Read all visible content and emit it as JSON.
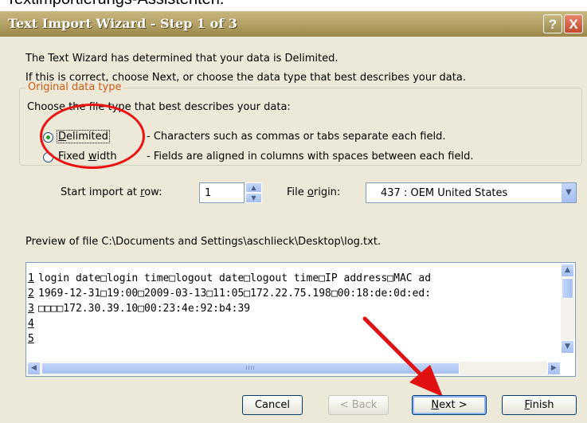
{
  "caption": "Textimportierungs-Assistenten.",
  "window": {
    "title": "Text Import Wizard - Step 1 of 3",
    "help_glyph": "?",
    "close_glyph": "X"
  },
  "intro": {
    "line1": "The Text Wizard has determined that your data is Delimited.",
    "line2": "If this is correct, choose Next, or choose the data type that best describes your data."
  },
  "original_data_type": {
    "legend": "Original data type",
    "prompt": "Choose the file type that best describes your data:",
    "options": [
      {
        "label_first": "D",
        "label_rest": "elimited",
        "description": "- Characters such as commas or tabs separate each field.",
        "selected": true
      },
      {
        "label_pre": "Fixed ",
        "label_u": "w",
        "label_post": "idth",
        "description": "- Fields are aligned in columns with spaces between each field.",
        "selected": false
      }
    ]
  },
  "start_import": {
    "label_pre": "Start import at ",
    "label_u": "r",
    "label_post": "ow:",
    "value": "1"
  },
  "file_origin": {
    "label_pre": "File ",
    "label_u": "o",
    "label_post": "rigin:",
    "value": "437 : OEM United States"
  },
  "preview": {
    "label": "Preview of file C:\\Documents and Settings\\aschlieck\\Desktop\\log.txt.",
    "rows": [
      {
        "num": "1",
        "text": "login date□login time□logout date□logout time□IP address□MAC ad"
      },
      {
        "num": "2",
        "text": "1969-12-31□19:00□2009-03-13□11:05□172.22.75.198□00:18:de:0d:ed:"
      },
      {
        "num": "3",
        "text": "□□□□172.30.39.10□00:23:4e:92:b4:39"
      },
      {
        "num": "4",
        "text": ""
      },
      {
        "num": "5",
        "text": ""
      }
    ],
    "hthumb_grip": "IIII"
  },
  "buttons": {
    "cancel": "Cancel",
    "back": "< Back",
    "next_u": "N",
    "next_rest": "ext >",
    "finish_u": "F",
    "finish_rest": "inish"
  },
  "icons": {
    "up": "▲",
    "down": "▼",
    "left": "◀",
    "right": "▶"
  },
  "colors": {
    "annotation": "#e11111",
    "legend": "#d45a12",
    "titlebar": "#b6a46a"
  }
}
